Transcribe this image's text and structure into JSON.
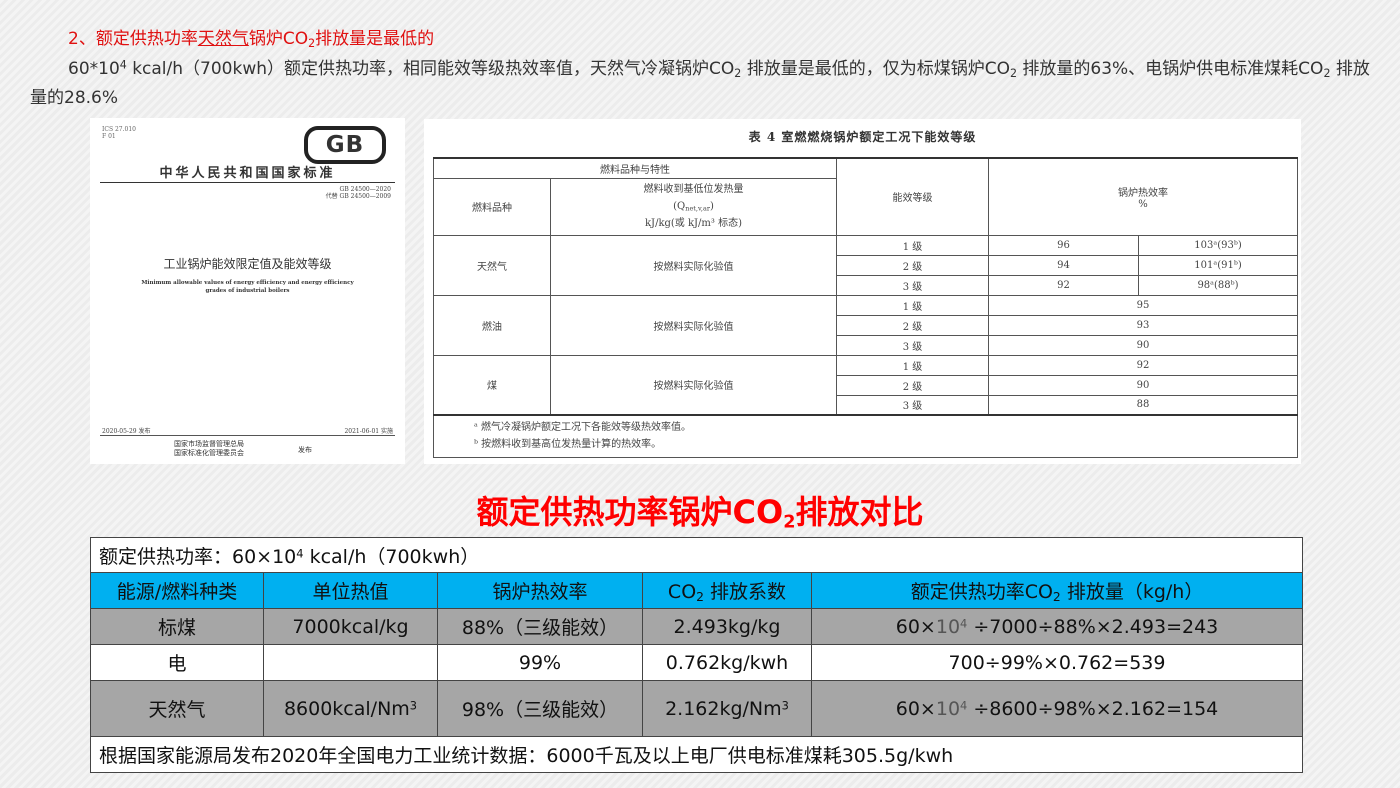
{
  "heading": {
    "prefix": "2、额定供热功率",
    "underlined": "天然气",
    "middle": "锅炉CO",
    "sub": "2",
    "suffix": "排放量是最低的"
  },
  "paragraph": {
    "p1": "60*10",
    "p1_sup": "4",
    "p2": " kcal/h（700kwh）额定供热功率，相同能效等级热效率值，天然气冷凝锅炉CO",
    "p2_sub": "2",
    "p3": " 排放量是最低的，仅为标煤锅炉CO",
    "p3_sub": "2",
    "p4": " 排放量的63%、电锅炉供电标准煤耗CO",
    "p4_sub": "2",
    "p5": " 排放量的28.6%"
  },
  "cover": {
    "ics": "ICS 27.010",
    "ccs": "F 01",
    "logo": "GB",
    "national_standard": "中华人民共和国国家标准",
    "code": "GB 24500—2020",
    "replaces": "代替 GB 24500—2009",
    "title_cn": "工业锅炉能效限定值及能效等级",
    "title_en_1": "Minimum allowable values of energy efficiency and energy efficiency",
    "title_en_2": "grades of industrial boilers",
    "issued": "2020-05-29 发布",
    "effective": "2021-06-01 实施",
    "publisher_1": "国家市场监督管理总局",
    "publisher_2": "国家标准化管理委员会",
    "publish_word": "发布"
  },
  "table4": {
    "caption": "表 4    室燃燃烧锅炉额定工况下能效等级",
    "h_fuel_group": "燃料品种与特性",
    "h_fuel_type": "燃料品种",
    "h_heat_1": "燃料收到基低位发热量",
    "h_heat_2": "(Q",
    "h_heat_2_sub": "net,v,ar",
    "h_heat_2_end": ")",
    "h_heat_3": "kJ/kg(或 kJ/m³ 标态)",
    "h_grade": "能效等级",
    "h_eff": "锅炉热效率",
    "h_eff_unit": "%",
    "gas": "天然气",
    "oil": "燃油",
    "coal": "煤",
    "test_note": "按燃料实际化验值",
    "g1": "1 级",
    "g2": "2 级",
    "g3": "3 级",
    "gas_v1": "96",
    "gas_c1": "103ᵃ(93ᵇ)",
    "gas_v2": "94",
    "gas_c2": "101ᵃ(91ᵇ)",
    "gas_v3": "92",
    "gas_c3": "98ᵃ(88ᵇ)",
    "oil_v1": "95",
    "oil_v2": "93",
    "oil_v3": "90",
    "coal_v1": "92",
    "coal_v2": "90",
    "coal_v3": "88",
    "note_a": "ᵃ  燃气冷凝锅炉额定工况下各能效等级热效率值。",
    "note_b": "ᵇ  按燃料收到基高位发热量计算的热效率。"
  },
  "big_title": {
    "a": "额定供热功率锅炉CO",
    "sub": "2",
    "b": "排放对比"
  },
  "compare": {
    "rated_a": "额定供热功率：60×10",
    "rated_sup": "4",
    "rated_b": " kcal/h（700kwh）",
    "headers": {
      "fuel": "能源/燃料种类",
      "unit_heat": "单位热值",
      "eff": "锅炉热效率",
      "co2_a": "CO",
      "co2_sub": "2",
      "co2_b": " 排放系数",
      "emis_a": "额定供热功率CO",
      "emis_sub": "2",
      "emis_b": " 排放量（kg/h）"
    },
    "coal": {
      "name": "标煤",
      "heat": "7000kcal/kg",
      "eff": "88%（三级能效）",
      "factor": "2.493kg/kg",
      "calc_a": "60×",
      "calc_ten": "10",
      "calc_sup": "4",
      "calc_b": " ÷7000÷88%×2.493=243"
    },
    "elec": {
      "name": "电",
      "heat": "",
      "eff": "99%",
      "factor": "0.762kg/kwh",
      "calc": "700÷99%×0.762=539"
    },
    "gas": {
      "name": "天然气",
      "heat_a": "8600kcal/Nm",
      "heat_sup": "3",
      "eff": "98%（三级能效）",
      "factor_a": "2.162kg/Nm",
      "factor_sup": "3",
      "calc_a": "60×",
      "calc_ten": "10",
      "calc_sup": "4",
      "calc_b": " ÷8600÷98%×2.162=154"
    },
    "footnote": "根据国家能源局发布2020年全国电力工业统计数据：6000千瓦及以上电厂供电标准煤耗305.5g/kwh"
  }
}
